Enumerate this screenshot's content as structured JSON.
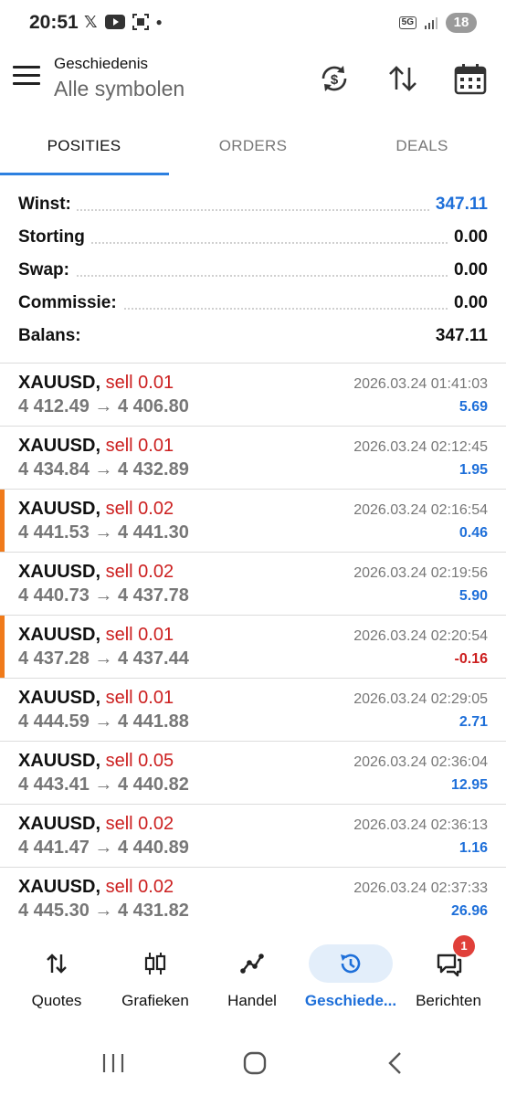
{
  "status_bar": {
    "time": "20:51",
    "left_icons": [
      "x-icon",
      "youtube-icon",
      "screenshot-icon",
      "dot-icon"
    ],
    "network": "5G",
    "battery": "18"
  },
  "app_bar": {
    "title": "Geschiedenis",
    "subtitle": "Alle symbolen",
    "actions": [
      "history-currency-icon",
      "sort-icon",
      "calendar-icon"
    ]
  },
  "tabs": [
    {
      "label": "POSITIES",
      "active": true
    },
    {
      "label": "ORDERS",
      "active": false
    },
    {
      "label": "DEALS",
      "active": false
    }
  ],
  "summary": {
    "profit": {
      "label": "Winst:",
      "value": "347.11"
    },
    "deposit": {
      "label": "Storting",
      "value": "0.00"
    },
    "swap": {
      "label": "Swap:",
      "value": "0.00"
    },
    "commission": {
      "label": "Commissie:",
      "value": "0.00"
    },
    "balance": {
      "label": "Balans:",
      "value": "347.11"
    }
  },
  "deals": [
    {
      "symbol": "XAUUSD,",
      "side": "sell 0.01",
      "prices": "4 412.49 → 4 406.80",
      "time": "2026.03.24 01:41:03",
      "profit": "5.69",
      "marked": false,
      "negative": false
    },
    {
      "symbol": "XAUUSD,",
      "side": "sell 0.01",
      "prices": "4 434.84 → 4 432.89",
      "time": "2026.03.24 02:12:45",
      "profit": "1.95",
      "marked": false,
      "negative": false
    },
    {
      "symbol": "XAUUSD,",
      "side": "sell 0.02",
      "prices": "4 441.53 → 4 441.30",
      "time": "2026.03.24 02:16:54",
      "profit": "0.46",
      "marked": true,
      "negative": false
    },
    {
      "symbol": "XAUUSD,",
      "side": "sell 0.02",
      "prices": "4 440.73 → 4 437.78",
      "time": "2026.03.24 02:19:56",
      "profit": "5.90",
      "marked": false,
      "negative": false
    },
    {
      "symbol": "XAUUSD,",
      "side": "sell 0.01",
      "prices": "4 437.28 → 4 437.44",
      "time": "2026.03.24 02:20:54",
      "profit": "-0.16",
      "marked": true,
      "negative": true
    },
    {
      "symbol": "XAUUSD,",
      "side": "sell 0.01",
      "prices": "4 444.59 → 4 441.88",
      "time": "2026.03.24 02:29:05",
      "profit": "2.71",
      "marked": false,
      "negative": false
    },
    {
      "symbol": "XAUUSD,",
      "side": "sell 0.05",
      "prices": "4 443.41 → 4 440.82",
      "time": "2026.03.24 02:36:04",
      "profit": "12.95",
      "marked": false,
      "negative": false
    },
    {
      "symbol": "XAUUSD,",
      "side": "sell 0.02",
      "prices": "4 441.47 → 4 440.89",
      "time": "2026.03.24 02:36:13",
      "profit": "1.16",
      "marked": false,
      "negative": false
    },
    {
      "symbol": "XAUUSD,",
      "side": "sell 0.02",
      "prices": "4 445.30 → 4 431.82",
      "time": "2026.03.24 02:37:33",
      "profit": "26.96",
      "marked": false,
      "negative": false
    }
  ],
  "bottom_nav": [
    {
      "label": "Quotes",
      "icon": "quotes-icon",
      "active": false
    },
    {
      "label": "Grafieken",
      "icon": "candlestick-icon",
      "active": false
    },
    {
      "label": "Handel",
      "icon": "trade-icon",
      "active": false
    },
    {
      "label": "Geschiede...",
      "icon": "history-icon",
      "active": true
    },
    {
      "label": "Berichten",
      "icon": "messages-icon",
      "active": false,
      "badge": "1"
    }
  ],
  "colors": {
    "accent": "#1e6fd9",
    "sell": "#cc1f1f",
    "marker": "#f07a1a"
  }
}
